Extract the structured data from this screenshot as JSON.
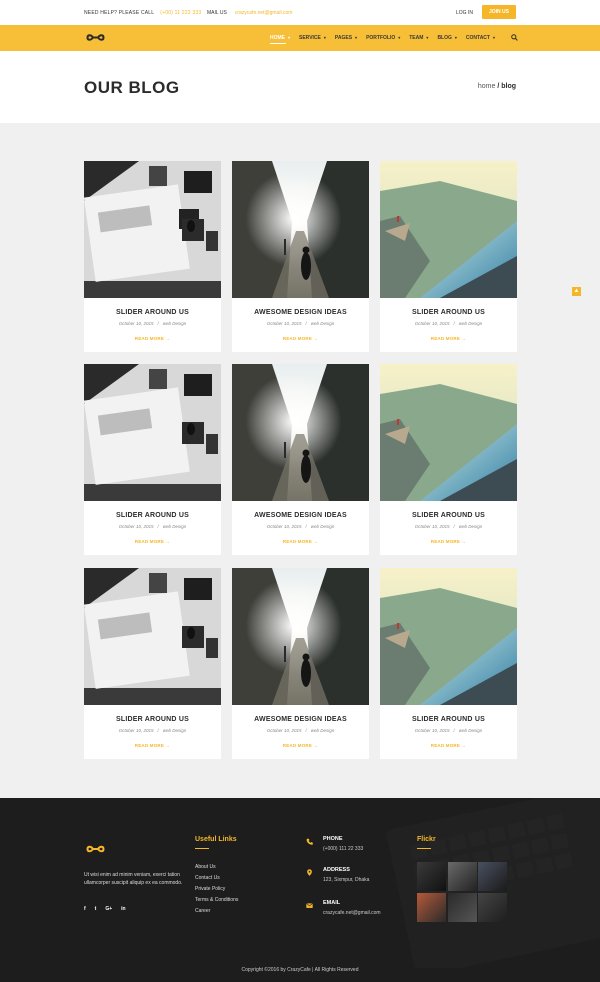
{
  "topbar": {
    "help_label": "NEED HELP? PLEASE CALL",
    "help_value": "(+00) 11 222 333",
    "mail_label": "MAIL US",
    "mail_value": "crazycafe.net@gmail.com",
    "login": "LOG IN",
    "join": "JOIN US"
  },
  "nav": {
    "items": [
      {
        "label": "HOME"
      },
      {
        "label": "SERVICE"
      },
      {
        "label": "PAGES"
      },
      {
        "label": "PORTFOLIO"
      },
      {
        "label": "TEAM"
      },
      {
        "label": "BLOG"
      },
      {
        "label": "CONTACT"
      }
    ],
    "icons": {
      "search": "search-icon",
      "caret": "▾"
    }
  },
  "page": {
    "title": "OUR BLOG",
    "breadcrumb_home": "home",
    "breadcrumb_current": "/ blog"
  },
  "posts": [
    {
      "title": "SLIDER AROUND US",
      "date": "October 10, 2015",
      "category": "web Design",
      "more": "READ MORE →"
    },
    {
      "title": "AWESOME DESIGN IDEAS",
      "date": "October 10, 2015",
      "category": "web Design",
      "more": "READ MORE →"
    },
    {
      "title": "SLIDER AROUND US",
      "date": "October 10, 2015",
      "category": "web Design",
      "more": "READ MORE →"
    },
    {
      "title": "SLIDER AROUND US",
      "date": "October 10, 2015",
      "category": "web Design",
      "more": "READ MORE →"
    },
    {
      "title": "AWESOME DESIGN IDEAS",
      "date": "October 10, 2015",
      "category": "web Design",
      "more": "READ MORE →"
    },
    {
      "title": "SLIDER AROUND US",
      "date": "October 10, 2015",
      "category": "web Design",
      "more": "READ MORE →"
    },
    {
      "title": "SLIDER AROUND US",
      "date": "October 10, 2015",
      "category": "web Design",
      "more": "READ MORE →"
    },
    {
      "title": "AWESOME DESIGN IDEAS",
      "date": "October 10, 2015",
      "category": "web Design",
      "more": "READ MORE →"
    },
    {
      "title": "SLIDER AROUND US",
      "date": "October 10, 2015",
      "category": "web Design",
      "more": "READ MORE →"
    }
  ],
  "scroll_top": "▲",
  "footer": {
    "description": "Ut wisi enim ad minim veniam, exerci tation ullamcorper suscipit aliquip ex ea commodo.",
    "social": [
      "f",
      "t",
      "G+",
      "in"
    ],
    "useful_links_title": "Useful Links",
    "links": [
      "About Us",
      "Contact Us",
      "Private Policy",
      "Terms & Conditions",
      "Career"
    ],
    "contact": [
      {
        "label": "PHONE",
        "value": "(+000) 111 22 333",
        "icon": "phone-icon"
      },
      {
        "label": "ADDRESS",
        "value": "123, Sixmpur, Dhaka",
        "icon": "location-pin-icon"
      },
      {
        "label": "EMAIL",
        "value": "crazycafe.net@gmail.com",
        "icon": "envelope-icon"
      }
    ],
    "flickr_title": "Flickr",
    "copyright": "Copyright ©2016 by CrazyCafe   |   All Rights Reserved"
  },
  "colors": {
    "accent": "#f5b729",
    "nav_bg": "#f7be38",
    "footer_bg": "#1d1d1d",
    "page_bg": "#f0f0f0"
  }
}
